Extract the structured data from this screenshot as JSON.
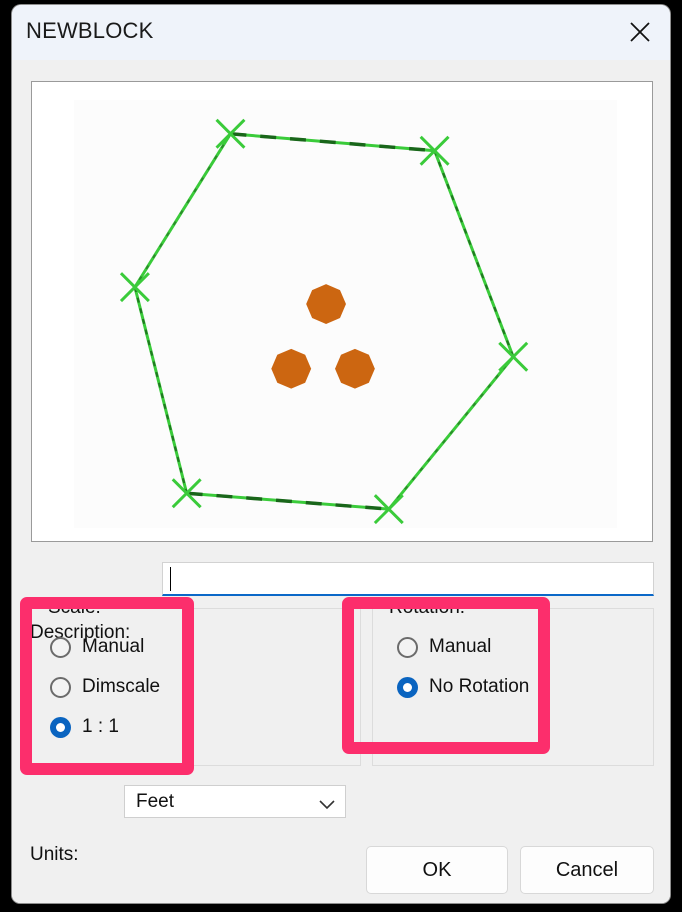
{
  "window": {
    "title": "NEWBLOCK",
    "close_icon": "close-icon"
  },
  "preview": {
    "label": "block-preview",
    "outline_color": "#33CC33",
    "outline_dark_color": "#1A6B1A",
    "node_color": "#CC6611",
    "background": "#FFFFFF"
  },
  "description": {
    "label": "Description:",
    "value": "",
    "placeholder": ""
  },
  "scale": {
    "title": "Scale:",
    "options": [
      {
        "label": "Manual",
        "selected": false
      },
      {
        "label": "Dimscale",
        "selected": false
      },
      {
        "label": "1 : 1",
        "selected": true
      }
    ]
  },
  "rotation": {
    "title": "Rotation:",
    "options": [
      {
        "label": "Manual",
        "selected": false
      },
      {
        "label": "No Rotation",
        "selected": true
      }
    ]
  },
  "units": {
    "label": "Units:",
    "value": "Feet",
    "chevron_icon": "chevron-down-icon"
  },
  "buttons": {
    "ok": "OK",
    "cancel": "Cancel"
  },
  "highlights": {
    "color": "#FC2E6C",
    "targets": [
      "scale-group",
      "rotation-group"
    ]
  },
  "colors": {
    "accent_blue": "#0A64C0",
    "focus_underline": "#0B68C8",
    "titlebar": "#EFF3FA",
    "dialog_bg": "#F0F0F0",
    "highlight_pink": "#FC2E6C",
    "node_orange": "#CC6611",
    "outline_green": "#33CC33"
  }
}
